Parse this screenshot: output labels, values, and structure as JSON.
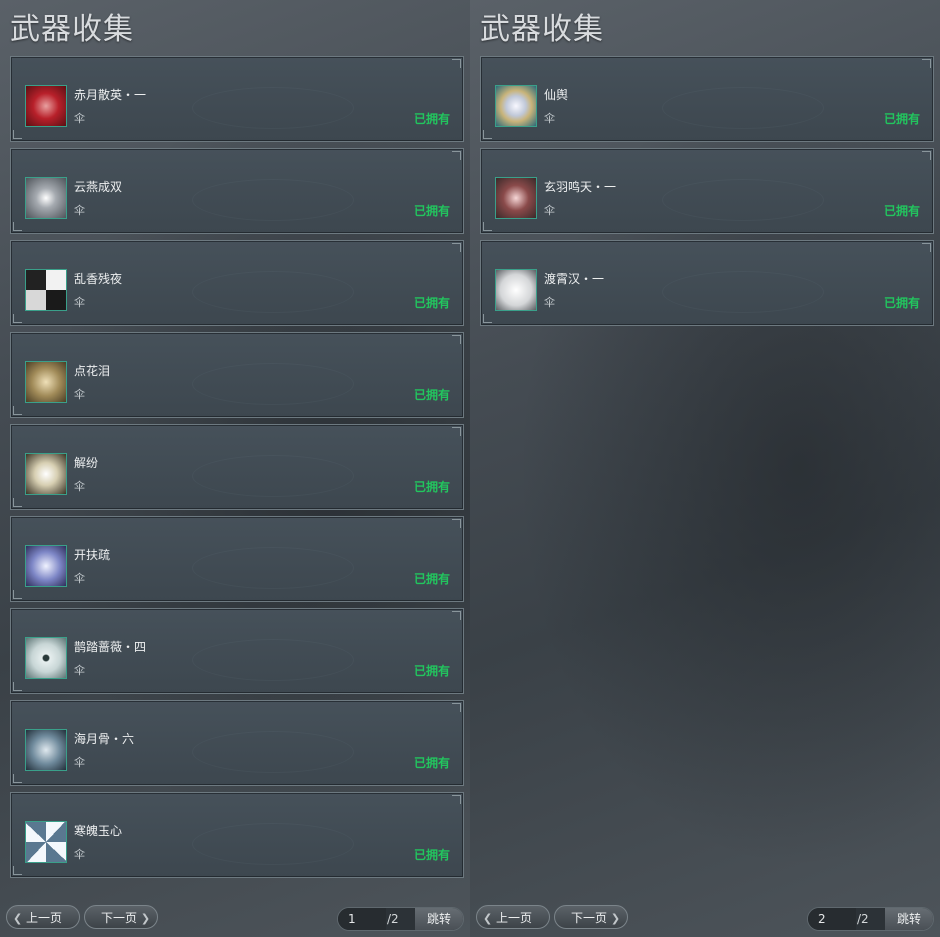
{
  "panels": [
    {
      "title": "武器收集",
      "items": [
        {
          "name": "赤月散英・一",
          "type": "伞",
          "status": "已拥有",
          "icon": "umbrella-red-icon",
          "color": "#b8202a"
        },
        {
          "name": "云燕成双",
          "type": "伞",
          "status": "已拥有",
          "icon": "umbrella-silver-icon",
          "color": "#8c9096"
        },
        {
          "name": "乱香残夜",
          "type": "伞",
          "status": "已拥有",
          "icon": "umbrella-black-white-icon",
          "color": "#2a2a2a"
        },
        {
          "name": "点花泪",
          "type": "伞",
          "status": "已拥有",
          "icon": "umbrella-gold-icon",
          "color": "#a08a58"
        },
        {
          "name": "解纷",
          "type": "伞",
          "status": "已拥有",
          "icon": "umbrella-ivory-icon",
          "color": "#d7cfb2"
        },
        {
          "name": "开扶疏",
          "type": "伞",
          "status": "已拥有",
          "icon": "umbrella-lavender-icon",
          "color": "#7d86c6"
        },
        {
          "name": "鹊踏蔷薇・四",
          "type": "伞",
          "status": "已拥有",
          "icon": "umbrella-pale-icon",
          "color": "#c8d6d6"
        },
        {
          "name": "海月骨・六",
          "type": "伞",
          "status": "已拥有",
          "icon": "umbrella-teal-icon",
          "color": "#6f8a9c"
        },
        {
          "name": "寒魄玉心",
          "type": "伞",
          "status": "已拥有",
          "icon": "umbrella-frost-icon",
          "color": "#9fb6c8"
        }
      ],
      "pager": {
        "prev_label": "上一页",
        "next_label": "下一页",
        "page": "1",
        "total": "/2",
        "jump_label": "跳转"
      }
    },
    {
      "title": "武器收集",
      "items": [
        {
          "name": "仙舆",
          "type": "伞",
          "status": "已拥有",
          "icon": "umbrella-jeweled-icon",
          "color": "#c9b47a"
        },
        {
          "name": "玄羽鸣天・一",
          "type": "伞",
          "status": "已拥有",
          "icon": "umbrella-rose-icon",
          "color": "#8a4a4a"
        },
        {
          "name": "渡霄汉・一",
          "type": "伞",
          "status": "已拥有",
          "icon": "umbrella-white-icon",
          "color": "#d4d6d8"
        }
      ],
      "pager": {
        "prev_label": "上一页",
        "next_label": "下一页",
        "page": "2",
        "total": "/2",
        "jump_label": "跳转"
      }
    }
  ]
}
